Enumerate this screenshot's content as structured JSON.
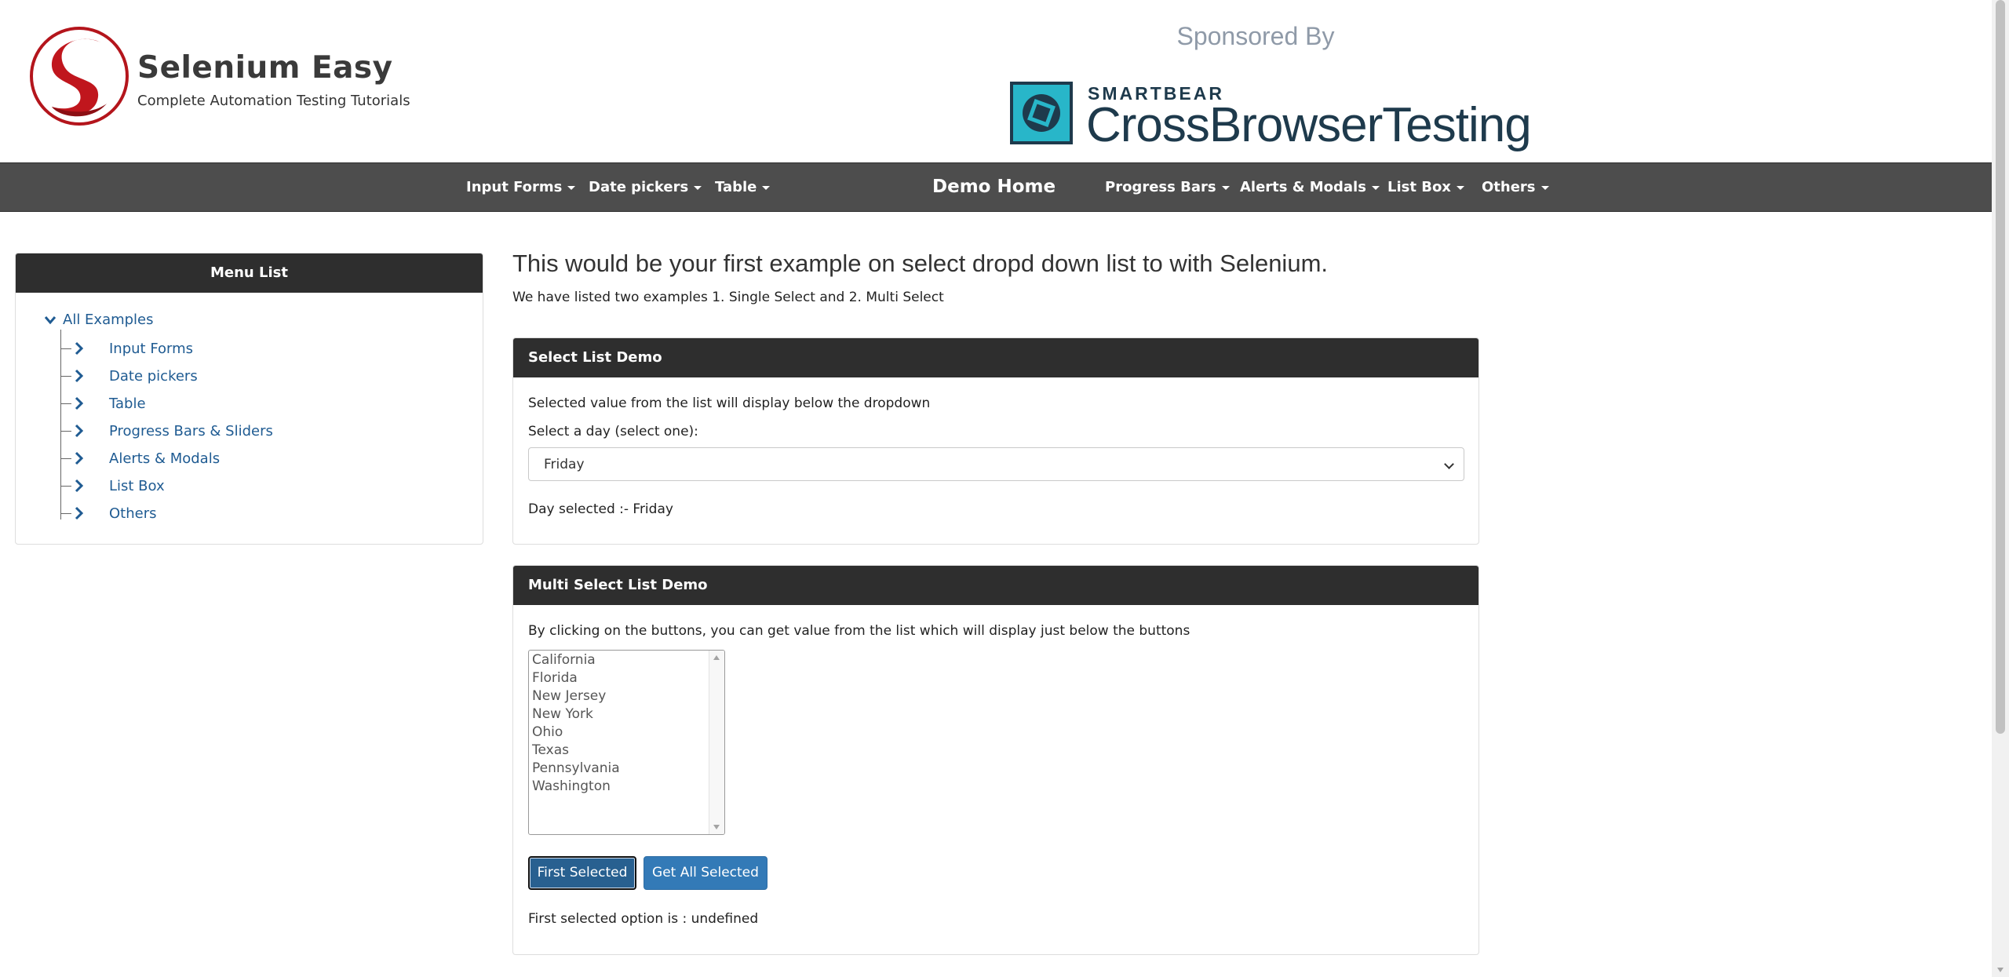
{
  "header": {
    "site_title": "Selenium Easy",
    "site_subtitle": "Complete Automation Testing Tutorials",
    "sponsored_label": "Sponsored By",
    "sponsor_brand": "SMARTBEAR",
    "sponsor_product": "CrossBrowserTesting"
  },
  "nav": {
    "items_left": [
      "Input Forms",
      "Date pickers",
      "Table"
    ],
    "home": "Demo Home",
    "items_right": [
      "Progress Bars",
      "Alerts & Modals",
      "List Box",
      "Others"
    ]
  },
  "sidebar": {
    "title": "Menu List",
    "root": "All Examples",
    "items": [
      "Input Forms",
      "Date pickers",
      "Table",
      "Progress Bars & Sliders",
      "Alerts & Modals",
      "List Box",
      "Others"
    ]
  },
  "main": {
    "heading": "This would be your first example on select dropd down list to with Selenium.",
    "subheading": "We have listed two examples 1. Single Select and 2. Multi Select"
  },
  "select_demo": {
    "title": "Select List Demo",
    "description": "Selected value from the list will display below the dropdown",
    "label": "Select a day (select one):",
    "selected_value": "Friday",
    "result": "Day selected :- Friday"
  },
  "multi_demo": {
    "title": "Multi Select List Demo",
    "description": "By clicking on the buttons, you can get value from the list which will display just below the buttons",
    "options": [
      "California",
      "Florida",
      "New Jersey",
      "New York",
      "Ohio",
      "Texas",
      "Pennsylvania",
      "Washington"
    ],
    "first_button": "First Selected",
    "all_button": "Get All Selected",
    "result": "First selected option is : undefined"
  },
  "colors": {
    "navbar": "#4d4d4d",
    "panel_header": "#2e2e2e",
    "link": "#1f5b92",
    "button": "#337ab7",
    "logo_red": "#c0161d",
    "sponsor_teal": "#28b6c9"
  }
}
